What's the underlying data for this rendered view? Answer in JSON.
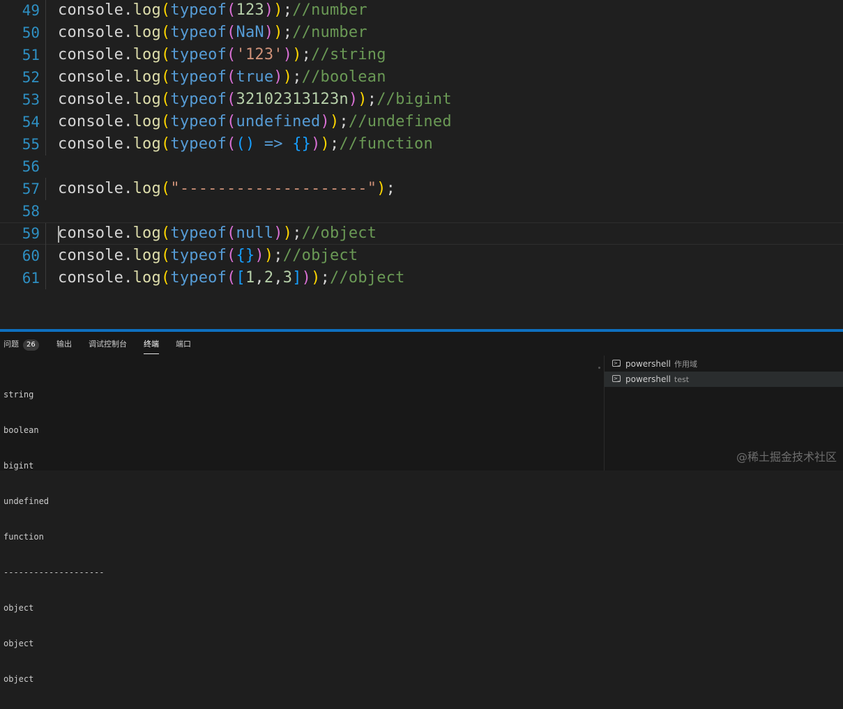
{
  "colors": {
    "text": "#d4d4d4",
    "method": "#dcdcaa",
    "keyword": "#569cd6",
    "number": "#b5cea8",
    "string": "#ce9178",
    "comment": "#6a9955",
    "bracket1": "#ffd700",
    "bracket2": "#da70d6",
    "bracket3": "#179fff",
    "line_number": "#2e8fc2",
    "accent": "#0e70c0"
  },
  "editor": {
    "lines": [
      {
        "num": "49",
        "tokens": [
          [
            "console",
            "text"
          ],
          [
            ".",
            "text"
          ],
          [
            "log",
            "method"
          ],
          [
            "(",
            "bracket1"
          ],
          [
            "typeof",
            "keyword"
          ],
          [
            "(",
            "bracket2"
          ],
          [
            "123",
            "number"
          ],
          [
            ")",
            "bracket2"
          ],
          [
            ")",
            "bracket1"
          ],
          [
            ";",
            "text"
          ],
          [
            "//number",
            "comment"
          ]
        ]
      },
      {
        "num": "50",
        "tokens": [
          [
            "console",
            "text"
          ],
          [
            ".",
            "text"
          ],
          [
            "log",
            "method"
          ],
          [
            "(",
            "bracket1"
          ],
          [
            "typeof",
            "keyword"
          ],
          [
            "(",
            "bracket2"
          ],
          [
            "NaN",
            "keyword"
          ],
          [
            ")",
            "bracket2"
          ],
          [
            ")",
            "bracket1"
          ],
          [
            ";",
            "text"
          ],
          [
            "//number",
            "comment"
          ]
        ]
      },
      {
        "num": "51",
        "tokens": [
          [
            "console",
            "text"
          ],
          [
            ".",
            "text"
          ],
          [
            "log",
            "method"
          ],
          [
            "(",
            "bracket1"
          ],
          [
            "typeof",
            "keyword"
          ],
          [
            "(",
            "bracket2"
          ],
          [
            "'123'",
            "string"
          ],
          [
            ")",
            "bracket2"
          ],
          [
            ")",
            "bracket1"
          ],
          [
            ";",
            "text"
          ],
          [
            "//string",
            "comment"
          ]
        ]
      },
      {
        "num": "52",
        "tokens": [
          [
            "console",
            "text"
          ],
          [
            ".",
            "text"
          ],
          [
            "log",
            "method"
          ],
          [
            "(",
            "bracket1"
          ],
          [
            "typeof",
            "keyword"
          ],
          [
            "(",
            "bracket2"
          ],
          [
            "true",
            "keyword"
          ],
          [
            ")",
            "bracket2"
          ],
          [
            ")",
            "bracket1"
          ],
          [
            ";",
            "text"
          ],
          [
            "//boolean",
            "comment"
          ]
        ]
      },
      {
        "num": "53",
        "tokens": [
          [
            "console",
            "text"
          ],
          [
            ".",
            "text"
          ],
          [
            "log",
            "method"
          ],
          [
            "(",
            "bracket1"
          ],
          [
            "typeof",
            "keyword"
          ],
          [
            "(",
            "bracket2"
          ],
          [
            "32102313123n",
            "number"
          ],
          [
            ")",
            "bracket2"
          ],
          [
            ")",
            "bracket1"
          ],
          [
            ";",
            "text"
          ],
          [
            "//bigint",
            "comment"
          ]
        ]
      },
      {
        "num": "54",
        "tokens": [
          [
            "console",
            "text"
          ],
          [
            ".",
            "text"
          ],
          [
            "log",
            "method"
          ],
          [
            "(",
            "bracket1"
          ],
          [
            "typeof",
            "keyword"
          ],
          [
            "(",
            "bracket2"
          ],
          [
            "undefined",
            "keyword"
          ],
          [
            ")",
            "bracket2"
          ],
          [
            ")",
            "bracket1"
          ],
          [
            ";",
            "text"
          ],
          [
            "//undefined",
            "comment"
          ]
        ]
      },
      {
        "num": "55",
        "tokens": [
          [
            "console",
            "text"
          ],
          [
            ".",
            "text"
          ],
          [
            "log",
            "method"
          ],
          [
            "(",
            "bracket1"
          ],
          [
            "typeof",
            "keyword"
          ],
          [
            "(",
            "bracket2"
          ],
          [
            "()",
            "bracket3"
          ],
          [
            " ",
            "text"
          ],
          [
            "=>",
            "keyword"
          ],
          [
            " ",
            "text"
          ],
          [
            "{}",
            "bracket3"
          ],
          [
            ")",
            "bracket2"
          ],
          [
            ")",
            "bracket1"
          ],
          [
            ";",
            "text"
          ],
          [
            "//function",
            "comment"
          ]
        ]
      },
      {
        "num": "56",
        "tokens": []
      },
      {
        "num": "57",
        "tokens": [
          [
            "console",
            "text"
          ],
          [
            ".",
            "text"
          ],
          [
            "log",
            "method"
          ],
          [
            "(",
            "bracket1"
          ],
          [
            "\"--------------------\"",
            "string"
          ],
          [
            ")",
            "bracket1"
          ],
          [
            ";",
            "text"
          ]
        ]
      },
      {
        "num": "58",
        "tokens": []
      },
      {
        "num": "59",
        "current": true,
        "tokens": [
          [
            "console",
            "text"
          ],
          [
            ".",
            "text"
          ],
          [
            "log",
            "method"
          ],
          [
            "(",
            "bracket1"
          ],
          [
            "typeof",
            "keyword"
          ],
          [
            "(",
            "bracket2"
          ],
          [
            "null",
            "keyword"
          ],
          [
            ")",
            "bracket2"
          ],
          [
            ")",
            "bracket1"
          ],
          [
            ";",
            "text"
          ],
          [
            "//object",
            "comment"
          ]
        ]
      },
      {
        "num": "60",
        "tokens": [
          [
            "console",
            "text"
          ],
          [
            ".",
            "text"
          ],
          [
            "log",
            "method"
          ],
          [
            "(",
            "bracket1"
          ],
          [
            "typeof",
            "keyword"
          ],
          [
            "(",
            "bracket2"
          ],
          [
            "{}",
            "bracket3"
          ],
          [
            ")",
            "bracket2"
          ],
          [
            ")",
            "bracket1"
          ],
          [
            ";",
            "text"
          ],
          [
            "//object",
            "comment"
          ]
        ]
      },
      {
        "num": "61",
        "tokens": [
          [
            "console",
            "text"
          ],
          [
            ".",
            "text"
          ],
          [
            "log",
            "method"
          ],
          [
            "(",
            "bracket1"
          ],
          [
            "typeof",
            "keyword"
          ],
          [
            "(",
            "bracket2"
          ],
          [
            "[",
            "bracket3"
          ],
          [
            "1",
            "number"
          ],
          [
            ",",
            "text"
          ],
          [
            "2",
            "number"
          ],
          [
            ",",
            "text"
          ],
          [
            "3",
            "number"
          ],
          [
            "]",
            "bracket3"
          ],
          [
            ")",
            "bracket2"
          ],
          [
            ")",
            "bracket1"
          ],
          [
            ";",
            "text"
          ],
          [
            "//object",
            "comment"
          ]
        ]
      }
    ]
  },
  "panel": {
    "tabs": {
      "problems": "问题",
      "problems_count": "26",
      "output": "输出",
      "debug_console": "调试控制台",
      "terminal": "终端",
      "ports": "端口"
    },
    "terminal_lines": [
      "string",
      "boolean",
      "bigint",
      "undefined",
      "function",
      "--------------------",
      "object",
      "object",
      "object"
    ],
    "terminal_list": [
      {
        "name": "powershell",
        "desc": "作用域"
      },
      {
        "name": "powershell",
        "desc": "test"
      }
    ]
  },
  "watermark": "@稀土掘金技术社区"
}
